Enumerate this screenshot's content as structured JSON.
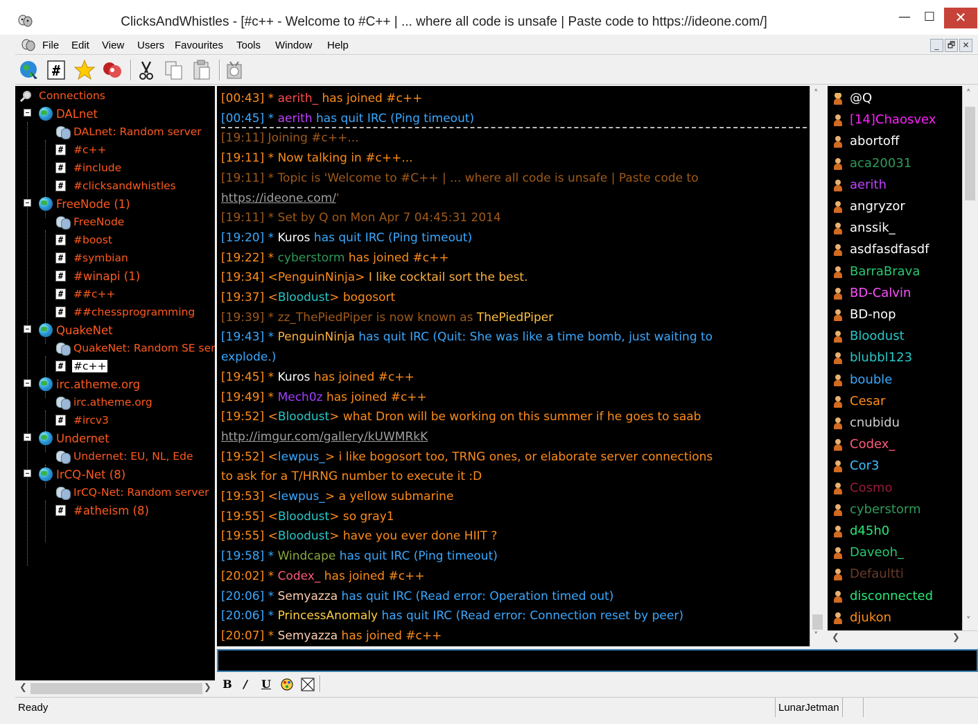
{
  "window": {
    "title": "ClicksAndWhistles - [#c++ - Welcome to #C++ | ... where all code is unsafe | Paste code to https://ideone.com/]",
    "minimize": "—",
    "maximize": "☐",
    "close": "✕"
  },
  "menu": [
    "File",
    "Edit",
    "View",
    "Users",
    "Favourites",
    "Tools",
    "Window",
    "Help"
  ],
  "mdi_controls": [
    "_",
    "🗗",
    "✕"
  ],
  "toolbar_icons": [
    "globe-icon",
    "channel-icon",
    "favourites-star-icon",
    "disconnect-icon",
    "cut-icon",
    "copy-icon",
    "paste-icon",
    "options-icon"
  ],
  "tree": {
    "root": "Connections",
    "nodes": [
      {
        "label": "DALnet",
        "type": "network"
      },
      {
        "label": "DALnet: Random server",
        "type": "server"
      },
      {
        "label": "#c++",
        "type": "channel"
      },
      {
        "label": "#include",
        "type": "channel"
      },
      {
        "label": "#clicksandwhistles",
        "type": "channel"
      },
      {
        "label": "FreeNode (1)",
        "type": "network"
      },
      {
        "label": "FreeNode",
        "type": "server"
      },
      {
        "label": "#boost",
        "type": "channel"
      },
      {
        "label": "#symbian",
        "type": "channel"
      },
      {
        "label": "#winapi (1)",
        "type": "channel"
      },
      {
        "label": "##c++",
        "type": "channel"
      },
      {
        "label": "##chessprogramming",
        "type": "channel"
      },
      {
        "label": "QuakeNet",
        "type": "network"
      },
      {
        "label": "QuakeNet: Random SE server",
        "type": "server"
      },
      {
        "label": "#c++",
        "type": "channel",
        "selected": true
      },
      {
        "label": "irc.atheme.org",
        "type": "network"
      },
      {
        "label": "irc.atheme.org",
        "type": "server"
      },
      {
        "label": "#ircv3",
        "type": "channel"
      },
      {
        "label": "Undernet",
        "type": "network"
      },
      {
        "label": "Undernet: EU, NL, Ede",
        "type": "server"
      },
      {
        "label": "IrCQ-Net (8)",
        "type": "network"
      },
      {
        "label": "IrCQ-Net: Random server",
        "type": "server"
      },
      {
        "label": "#atheism (8)",
        "type": "channel"
      }
    ]
  },
  "chat": {
    "lines": [
      {
        "parts": [
          {
            "t": "[00:43] * ",
            "c": "#ff8c1a"
          },
          {
            "t": "aerith_",
            "c": "#ff4a4a"
          },
          {
            "t": " has joined #c++",
            "c": "#ff8c1a"
          }
        ]
      },
      {
        "parts": [
          {
            "t": "[00:45] * ",
            "c": "#3aa8ff"
          },
          {
            "t": "aerith",
            "c": "#c040ff"
          },
          {
            "t": " has quit IRC (Ping timeout)",
            "c": "#3aa8ff"
          }
        ]
      },
      {
        "parts": [
          {
            "t": "[19:11] Joining #c++...",
            "c": "#a05a1a"
          }
        ]
      },
      {
        "parts": [
          {
            "t": "[19:11] * Now talking in #c++...",
            "c": "#ff8c1a"
          }
        ]
      },
      {
        "parts": [
          {
            "t": "[19:11] * Topic is 'Welcome to #C++ | ... where all code is unsafe | Paste code to",
            "c": "#a05a1a"
          }
        ]
      },
      {
        "parts": [
          {
            "t": "https://ideone.com/",
            "c": "#a0a0a0",
            "u": true
          },
          {
            "t": "'",
            "c": "#a05a1a"
          }
        ]
      },
      {
        "parts": [
          {
            "t": "[19:11] * Set by Q on Mon Apr 7 04:45:31 2014",
            "c": "#a05a1a"
          }
        ]
      },
      {
        "parts": [
          {
            "t": "[19:20] * ",
            "c": "#3aa8ff"
          },
          {
            "t": "Kuros",
            "c": "#ffffff"
          },
          {
            "t": " has quit IRC (Ping timeout)",
            "c": "#3aa8ff"
          }
        ]
      },
      {
        "parts": [
          {
            "t": "[19:22] * ",
            "c": "#ff8c1a"
          },
          {
            "t": "cyberstorm",
            "c": "#2f9a5a"
          },
          {
            "t": " has joined #c++",
            "c": "#ff8c1a"
          }
        ]
      },
      {
        "parts": [
          {
            "t": "[19:34] <PenguinNinja> ",
            "c": "#ff8c1a"
          },
          {
            "t": "I like cocktail sort the best.",
            "c": "#ffb040"
          }
        ]
      },
      {
        "parts": [
          {
            "t": "[19:37] <",
            "c": "#ff8c1a"
          },
          {
            "t": "Bloodust",
            "c": "#28c8c8"
          },
          {
            "t": "> bogosort",
            "c": "#ff8c1a"
          }
        ]
      },
      {
        "parts": [
          {
            "t": "[19:39] * zz_ThePiedPiper is now known as ",
            "c": "#a05a1a"
          },
          {
            "t": "ThePiedPiper",
            "c": "#ffc040"
          }
        ]
      },
      {
        "parts": [
          {
            "t": "[19:43] * ",
            "c": "#3aa8ff"
          },
          {
            "t": "PenguinNinja",
            "c": "#ffb040"
          },
          {
            "t": " has quit IRC (Quit: She was like a time bomb, just waiting to",
            "c": "#3aa8ff"
          }
        ]
      },
      {
        "parts": [
          {
            "t": "explode.)",
            "c": "#3aa8ff"
          }
        ]
      },
      {
        "parts": [
          {
            "t": "[19:45] * ",
            "c": "#ff8c1a"
          },
          {
            "t": "Kuros",
            "c": "#ffffff"
          },
          {
            "t": " has joined #c++",
            "c": "#ff8c1a"
          }
        ]
      },
      {
        "parts": [
          {
            "t": "[19:49] * ",
            "c": "#ff8c1a"
          },
          {
            "t": "Mech0z",
            "c": "#a040ff"
          },
          {
            "t": " has joined #c++",
            "c": "#ff8c1a"
          }
        ]
      },
      {
        "parts": [
          {
            "t": "[19:52] <",
            "c": "#ff8c1a"
          },
          {
            "t": "Bloodust",
            "c": "#28c8c8"
          },
          {
            "t": "> what Dron will be working on this summer if he goes to saab",
            "c": "#ff8c1a"
          }
        ]
      },
      {
        "parts": [
          {
            "t": "http://imgur.com/gallery/kUWMRkK",
            "c": "#a0a0a0",
            "u": true
          }
        ]
      },
      {
        "parts": [
          {
            "t": "[19:52] <",
            "c": "#ff8c1a"
          },
          {
            "t": "lewpus_",
            "c": "#3aa8ff"
          },
          {
            "t": "> i like bogosort too, TRNG ones, or elaborate server connections",
            "c": "#ff8c1a"
          }
        ]
      },
      {
        "parts": [
          {
            "t": "to ask for a T/HRNG number to execute it :D",
            "c": "#ff8c1a"
          }
        ]
      },
      {
        "parts": [
          {
            "t": "[19:53] <",
            "c": "#ff8c1a"
          },
          {
            "t": "lewpus_",
            "c": "#3aa8ff"
          },
          {
            "t": "> a yellow submarine",
            "c": "#ff8c1a"
          }
        ]
      },
      {
        "parts": [
          {
            "t": "[19:55] <",
            "c": "#ff8c1a"
          },
          {
            "t": "Bloodust",
            "c": "#28c8c8"
          },
          {
            "t": "> so gray1",
            "c": "#ff8c1a"
          }
        ]
      },
      {
        "parts": [
          {
            "t": "[19:55] <",
            "c": "#ff8c1a"
          },
          {
            "t": "Bloodust",
            "c": "#28c8c8"
          },
          {
            "t": "> have you ever done HIIT ?",
            "c": "#ff8c1a"
          }
        ]
      },
      {
        "parts": [
          {
            "t": "[19:58] * ",
            "c": "#3aa8ff"
          },
          {
            "t": "Windcape",
            "c": "#8aa840"
          },
          {
            "t": " has quit IRC (Ping timeout)",
            "c": "#3aa8ff"
          }
        ]
      },
      {
        "parts": [
          {
            "t": "[20:02] * ",
            "c": "#ff8c1a"
          },
          {
            "t": "Codex_",
            "c": "#ff5a7a"
          },
          {
            "t": " has joined #c++",
            "c": "#ff8c1a"
          }
        ]
      },
      {
        "parts": [
          {
            "t": "[20:06] * ",
            "c": "#3aa8ff"
          },
          {
            "t": "Semyazza",
            "c": "#ffd0b0"
          },
          {
            "t": " has quit IRC (Read error: Operation timed out)",
            "c": "#3aa8ff"
          }
        ]
      },
      {
        "parts": [
          {
            "t": "[20:06] * ",
            "c": "#3aa8ff"
          },
          {
            "t": "PrincessAnomaly",
            "c": "#ffd040"
          },
          {
            "t": " has quit IRC (Read error: Connection reset by peer)",
            "c": "#3aa8ff"
          }
        ]
      },
      {
        "parts": [
          {
            "t": "[20:07] * ",
            "c": "#ff8c1a"
          },
          {
            "t": "Semyazza",
            "c": "#ffd0b0"
          },
          {
            "t": " has joined #c++",
            "c": "#ff8c1a"
          }
        ]
      }
    ]
  },
  "nicklist": [
    {
      "name": "@Q",
      "color": "#ffffff",
      "op": true
    },
    {
      "name": "[14]Chaosvex",
      "color": "#ff20ff"
    },
    {
      "name": "abortoff",
      "color": "#ffffff"
    },
    {
      "name": "aca20031",
      "color": "#2f9a5a"
    },
    {
      "name": "aerith",
      "color": "#c040ff"
    },
    {
      "name": "angryzor",
      "color": "#ffffff"
    },
    {
      "name": "anssik_",
      "color": "#ffffff"
    },
    {
      "name": "asdfasdfasdf",
      "color": "#ffffff"
    },
    {
      "name": "BarraBrava",
      "color": "#28c870"
    },
    {
      "name": "BD-Calvin",
      "color": "#ff50ff"
    },
    {
      "name": "BD-nop",
      "color": "#ffffff"
    },
    {
      "name": "Bloodust",
      "color": "#28c8c8"
    },
    {
      "name": "blubbl123",
      "color": "#28c8c8"
    },
    {
      "name": "bouble",
      "color": "#3aa8ff"
    },
    {
      "name": "Cesar",
      "color": "#ff8c1a"
    },
    {
      "name": "cnubidu",
      "color": "#d0d0d0"
    },
    {
      "name": "Codex_",
      "color": "#ff5a7a"
    },
    {
      "name": "Cor3",
      "color": "#40c0ff"
    },
    {
      "name": "Cosmo",
      "color": "#9a1a3a"
    },
    {
      "name": "cyberstorm",
      "color": "#2f9a5a"
    },
    {
      "name": "d45h0",
      "color": "#28e878"
    },
    {
      "name": "Daveoh_",
      "color": "#28c870"
    },
    {
      "name": "Defaultti",
      "color": "#6a3a2a"
    },
    {
      "name": "disconnected",
      "color": "#28e878"
    },
    {
      "name": "djukon",
      "color": "#ff8c1a"
    }
  ],
  "status": {
    "text": "Ready",
    "user": "LunarJetman"
  }
}
